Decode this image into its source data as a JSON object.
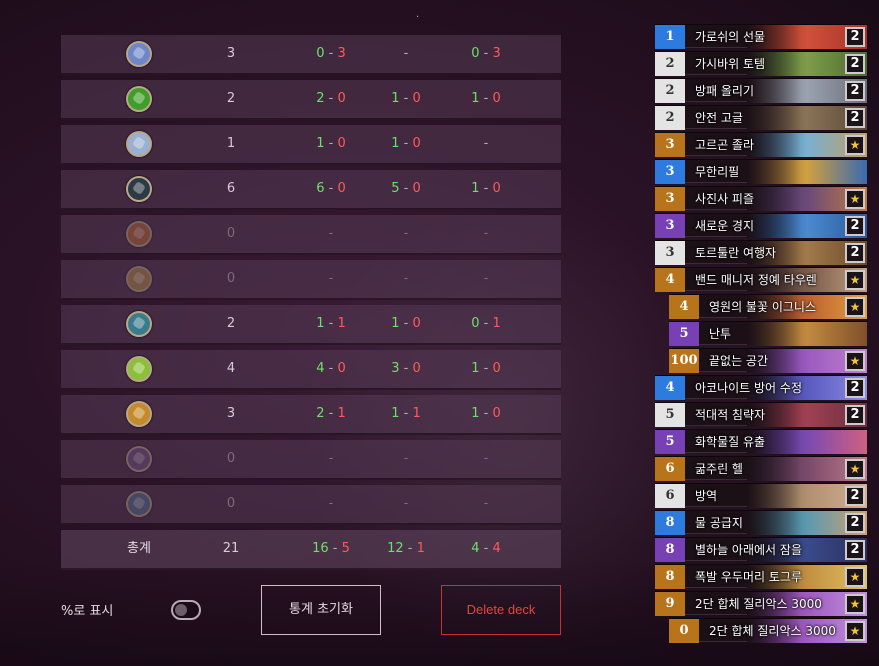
{
  "stats": {
    "rows": [
      {
        "icon": "mage-class-icon",
        "games": "3",
        "total_w": "0",
        "total_l": "3",
        "first_w": "",
        "first_l": "",
        "second_w": "0",
        "second_l": "3",
        "zero": false
      },
      {
        "icon": "hunter-class-icon",
        "games": "2",
        "total_w": "2",
        "total_l": "0",
        "first_w": "1",
        "first_l": "0",
        "second_w": "1",
        "second_l": "0",
        "zero": false
      },
      {
        "icon": "paladin-class-icon",
        "games": "1",
        "total_w": "1",
        "total_l": "0",
        "first_w": "1",
        "first_l": "0",
        "second_w": "",
        "second_l": "",
        "zero": false
      },
      {
        "icon": "rogue-class-icon",
        "games": "6",
        "total_w": "6",
        "total_l": "0",
        "first_w": "5",
        "first_l": "0",
        "second_w": "1",
        "second_l": "0",
        "zero": false
      },
      {
        "icon": "warrior-class-icon",
        "games": "0",
        "total_w": "",
        "total_l": "",
        "first_w": "",
        "first_l": "",
        "second_w": "",
        "second_l": "",
        "zero": true
      },
      {
        "icon": "priest-class-icon",
        "games": "0",
        "total_w": "",
        "total_l": "",
        "first_w": "",
        "first_l": "",
        "second_w": "",
        "second_l": "",
        "zero": true
      },
      {
        "icon": "shaman-class-icon",
        "games": "2",
        "total_w": "1",
        "total_l": "1",
        "first_w": "1",
        "first_l": "0",
        "second_w": "0",
        "second_l": "1",
        "zero": false
      },
      {
        "icon": "druid-class-icon",
        "games": "4",
        "total_w": "4",
        "total_l": "0",
        "first_w": "3",
        "first_l": "0",
        "second_w": "1",
        "second_l": "0",
        "zero": false
      },
      {
        "icon": "warlock-class-icon",
        "games": "3",
        "total_w": "2",
        "total_l": "1",
        "first_w": "1",
        "first_l": "1",
        "second_w": "1",
        "second_l": "0",
        "zero": false
      },
      {
        "icon": "demon-hunter-class-icon",
        "games": "0",
        "total_w": "",
        "total_l": "",
        "first_w": "",
        "first_l": "",
        "second_w": "",
        "second_l": "",
        "zero": true
      },
      {
        "icon": "death-knight-class-icon",
        "games": "0",
        "total_w": "",
        "total_l": "",
        "first_w": "",
        "first_l": "",
        "second_w": "",
        "second_l": "",
        "zero": true
      }
    ],
    "total": {
      "label": "총계",
      "games": "21",
      "total_w": "16",
      "total_l": "5",
      "first_w": "12",
      "first_l": "1",
      "second_w": "4",
      "second_l": "4"
    },
    "dash": "-",
    "sep": " - "
  },
  "controls": {
    "percent_label": "%로 표시",
    "percent_on": false,
    "reset_label": "통계 초기화",
    "delete_label": "Delete deck"
  },
  "colors": {
    "win": "#6ee06a",
    "loss": "#ff5a5a",
    "delete": "#e8443e"
  },
  "deck": [
    {
      "cost": "1",
      "name": "가로쉬의 선물",
      "count": "2",
      "rarity": "blue",
      "sub": false
    },
    {
      "cost": "2",
      "name": "가시바위 토템",
      "count": "2",
      "rarity": "white",
      "sub": false
    },
    {
      "cost": "2",
      "name": "방패 올리기",
      "count": "2",
      "rarity": "white",
      "sub": false
    },
    {
      "cost": "2",
      "name": "안전 고글",
      "count": "2",
      "rarity": "white",
      "sub": false
    },
    {
      "cost": "3",
      "name": "고르곤 졸라",
      "count": "★",
      "rarity": "gold",
      "sub": false
    },
    {
      "cost": "3",
      "name": "무한리필",
      "count": "",
      "rarity": "blue",
      "sub": false
    },
    {
      "cost": "3",
      "name": "사진사 피즐",
      "count": "★",
      "rarity": "gold",
      "sub": false
    },
    {
      "cost": "3",
      "name": "새로운 경지",
      "count": "2",
      "rarity": "purple",
      "sub": false
    },
    {
      "cost": "3",
      "name": "토르툴란 여행자",
      "count": "2",
      "rarity": "white",
      "sub": false
    },
    {
      "cost": "4",
      "name": "밴드 매니저 정예 타우렌",
      "count": "★",
      "rarity": "gold",
      "sub": false
    },
    {
      "cost": "4",
      "name": "영원의 불꽃 이그니스",
      "count": "★",
      "rarity": "gold",
      "sub": true
    },
    {
      "cost": "5",
      "name": "난투",
      "count": "",
      "rarity": "purple",
      "sub": true
    },
    {
      "cost": "100",
      "name": "끝없는 공간",
      "count": "★",
      "rarity": "gold",
      "sub": true
    },
    {
      "cost": "4",
      "name": "아코나이트 방어 수정",
      "count": "2",
      "rarity": "blue",
      "sub": false
    },
    {
      "cost": "5",
      "name": "적대적 침략자",
      "count": "2",
      "rarity": "white",
      "sub": false
    },
    {
      "cost": "5",
      "name": "화학물질 유출",
      "count": "",
      "rarity": "purple",
      "sub": false
    },
    {
      "cost": "6",
      "name": "굶주린 헬",
      "count": "★",
      "rarity": "gold",
      "sub": false
    },
    {
      "cost": "6",
      "name": "방역",
      "count": "2",
      "rarity": "white",
      "sub": false
    },
    {
      "cost": "8",
      "name": "물 공급지",
      "count": "2",
      "rarity": "blue",
      "sub": false
    },
    {
      "cost": "8",
      "name": "별하늘 아래에서 잠을",
      "count": "2",
      "rarity": "purple",
      "sub": false
    },
    {
      "cost": "8",
      "name": "폭발 우두머리 토그루",
      "count": "★",
      "rarity": "gold",
      "sub": false
    },
    {
      "cost": "9",
      "name": "2단 합체 질리악스 3000",
      "count": "★",
      "rarity": "gold",
      "sub": false
    },
    {
      "cost": "0",
      "name": "2단 합체 질리악스 3000",
      "count": "★",
      "rarity": "gold",
      "sub": true
    }
  ]
}
